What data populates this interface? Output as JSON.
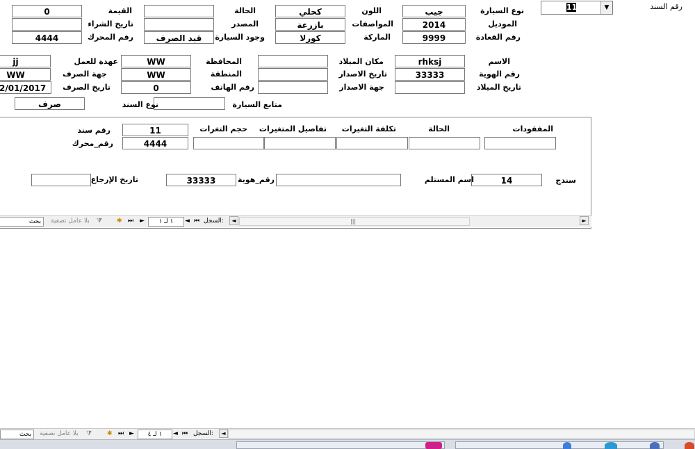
{
  "header": {
    "doc_number_label": "رقم السند",
    "doc_number_value": "11",
    "car_type_label": "نوع السيارة",
    "car_type_value": "جيب",
    "model_label": "الموديل",
    "model_value": "2014",
    "seats_label": "رقم القعادة",
    "seats_value": "9999",
    "color_label": "اللون",
    "color_value": "كحلي",
    "specs_label": "المواصفات",
    "specs_value": "بازرعة",
    "brand_label": "الماركة",
    "brand_value": "كورلا",
    "status_label": "الحالة",
    "status_value": "",
    "source_label": "المصدر",
    "source_value": "",
    "car_presence_label": "وجود السيارة",
    "car_presence_value": "قيد الصرف",
    "value_label": "القيمة",
    "value_value": "0",
    "purchase_date_label": "تاريخ الشراء",
    "purchase_date_value": "",
    "engine_no_label": "رقم المحرك",
    "engine_no_value": "4444"
  },
  "person": {
    "name_label": "الاسم",
    "name_value": "rhksj",
    "id_label": "رقم الهوية",
    "id_value": "33333",
    "birth_date_label": "تاريخ الميلاد",
    "birth_date_value": "",
    "birth_place_label": "مكان الميلاد",
    "birth_place_value": "",
    "issue_date_label": "تاريخ الاصدار",
    "issue_date_value": "",
    "issue_place_label": "جهة الاصدار",
    "issue_place_value": "",
    "governorate_label": "المحافظة",
    "governorate_value": "WW",
    "region_label": "المنطقة",
    "region_value": "WW",
    "phone_label": "رقم الهاتف",
    "phone_value": "0",
    "custody_label": "عهدة للعمل",
    "custody_value": "jj",
    "disburse_party_label": "جهة الصرف",
    "disburse_party_value": "WW",
    "disburse_date_label": "تاريخ الصرف",
    "disburse_date_value": "2/01/2017",
    "car_accessories_label": "متابع السيارة",
    "car_accessories_value": "",
    "doc_type_label": "نوع السند",
    "doc_type_value": "صرف"
  },
  "subform": {
    "headers": {
      "missing": "المفقودات",
      "status": "الحالة",
      "change_cost": "تكلفة التغيرات",
      "change_details": "تفاصيل المتغيرات",
      "change_size": "حجم التغرات"
    },
    "row": {
      "missing": "",
      "status": "",
      "change_cost": "",
      "change_details": "",
      "change_size": ""
    },
    "doc_no_label": "رقم سند",
    "doc_no_value": "11",
    "engine_label": "رقم_محرك",
    "engine_value": "4444",
    "voucher_label": "سندج",
    "voucher_value": "14",
    "receiver_label": "اسم المستلم",
    "receiver_value": "",
    "id_label": "رقم_هوية",
    "id_value": "33333",
    "return_date_label": "تاريخ الإرجاع",
    "return_date_value": ""
  },
  "subform_nav": {
    "record_label": "السجل:",
    "record_value": "١ لـ ١",
    "filter_label": "بلا عامل تصفية",
    "search_label": "بحث"
  },
  "main_nav": {
    "record_label": "السجل:",
    "record_value": "١ لـ ٤",
    "filter_label": "بلا عامل تصفية",
    "search_label": "بحث"
  }
}
